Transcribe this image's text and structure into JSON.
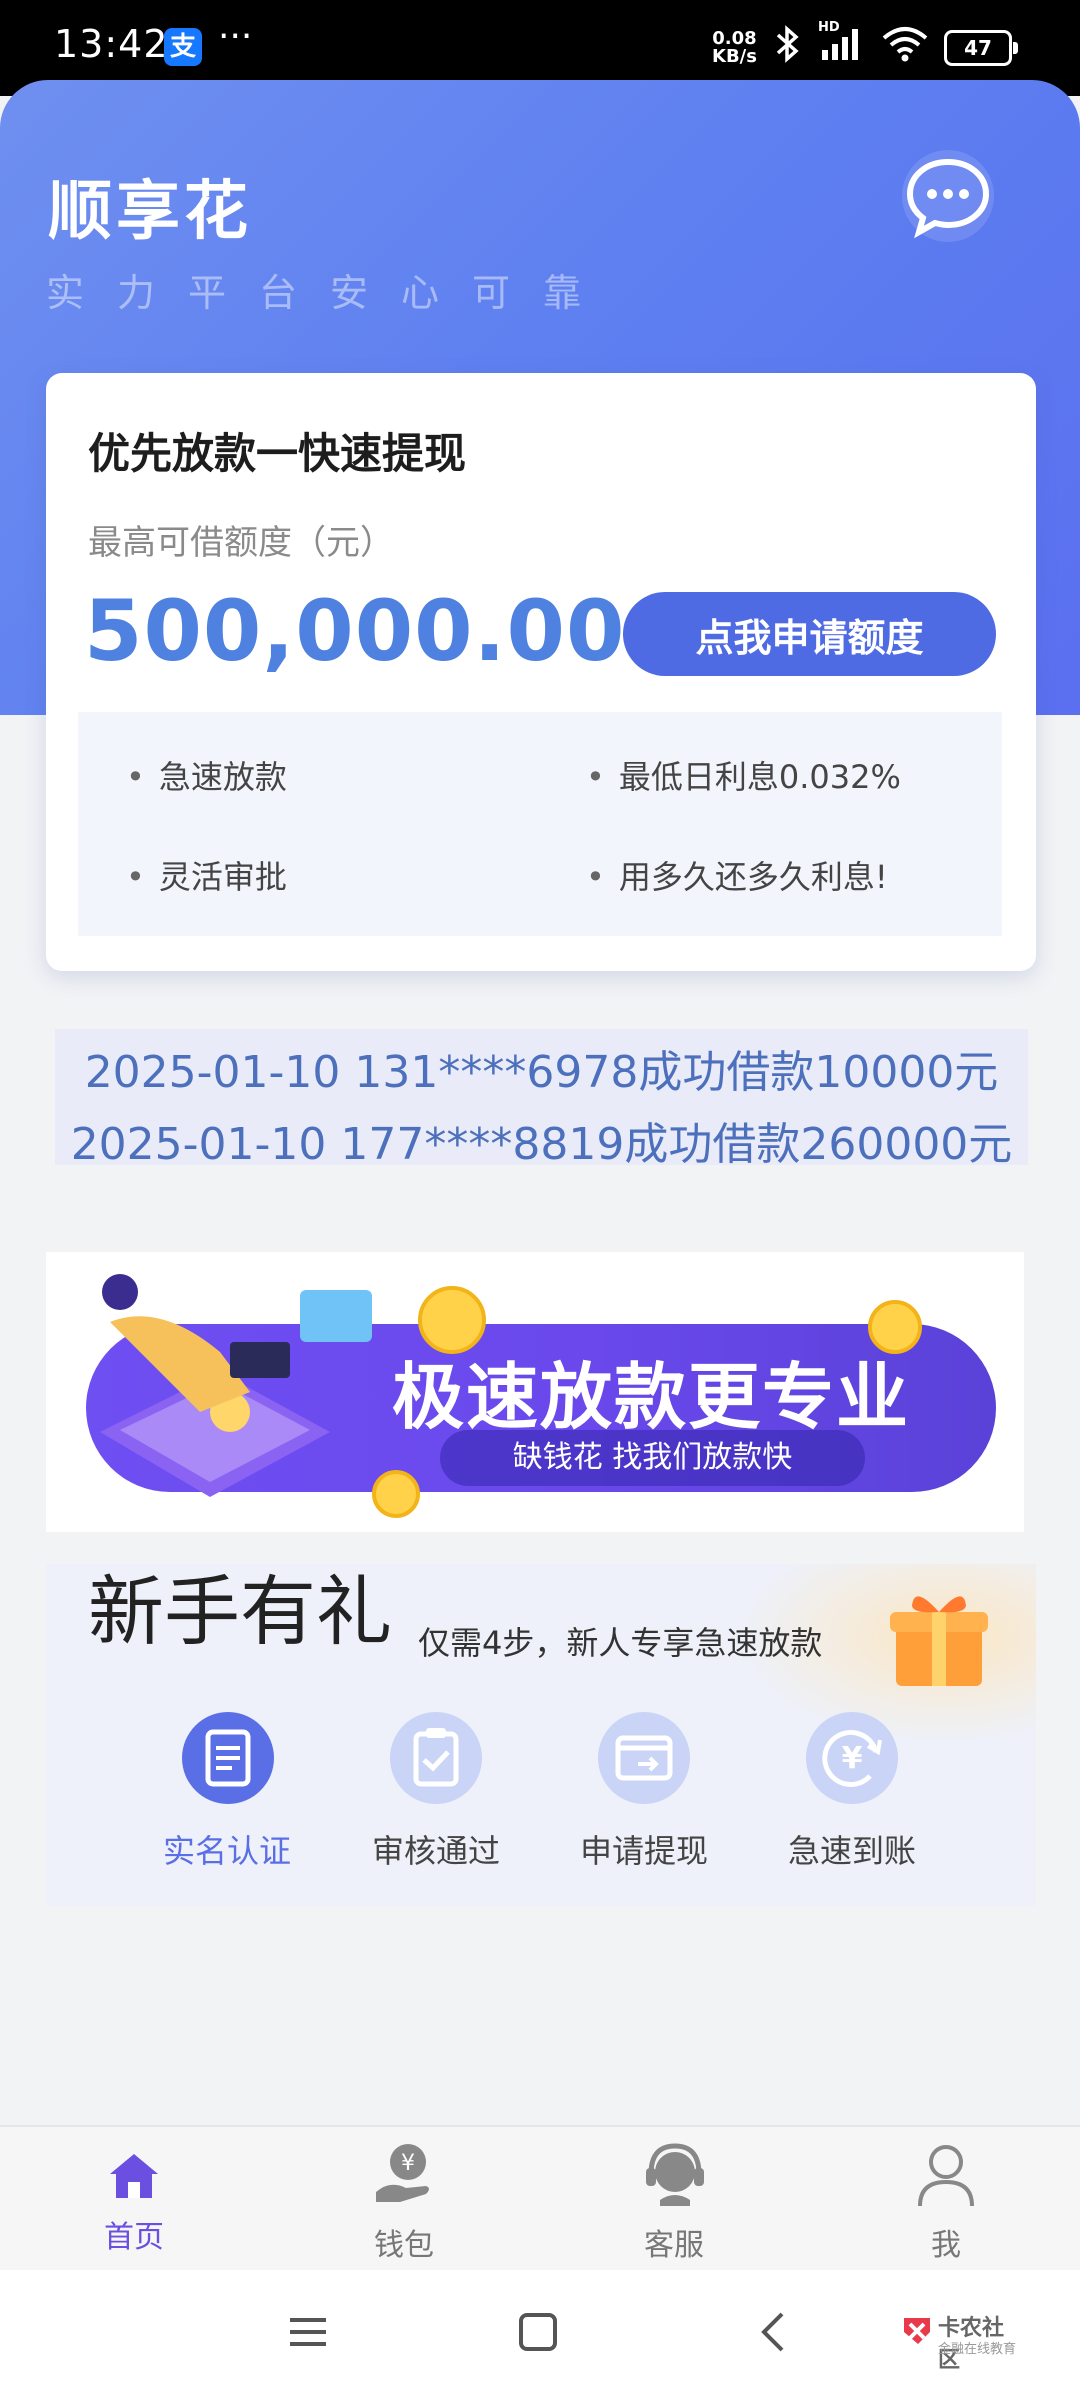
{
  "status_bar": {
    "time": "13:42",
    "app_icon": "支",
    "more": "···",
    "net_speed_top": "0.08",
    "net_speed_bottom": "KB/s",
    "battery": "47",
    "hd": "HD"
  },
  "header": {
    "brand": "顺享花",
    "slogan": "实力平台安心可靠"
  },
  "card": {
    "title": "优先放款一快速提现",
    "limit_label": "最高可借额度（元）",
    "amount": "500,000.00",
    "apply_button": "点我申请额度",
    "features": [
      "急速放款",
      "最低日利息0.032%",
      "灵活审批",
      "用多久还多久利息!"
    ]
  },
  "records": [
    "2025-01-10 131****6978成功借款10000元",
    "2025-01-10 177****8819成功借款260000元"
  ],
  "banner": {
    "title": "极速放款更专业",
    "subtitle": "缺钱花  找我们放款快"
  },
  "newbie": {
    "title": "新手有礼",
    "subtitle": "仅需4步，新人专享急速放款",
    "steps": [
      "实名认证",
      "审核通过",
      "申请提现",
      "急速到账"
    ],
    "yen": "¥"
  },
  "tabs": [
    "首页",
    "钱包",
    "客服",
    "我"
  ],
  "watermark": {
    "title": "卡农社区",
    "sub": "金融在线教育"
  },
  "colors": {
    "primary": "#4f6be3",
    "accent_text": "#4f82e0",
    "active_tab": "#6a4fe0"
  }
}
